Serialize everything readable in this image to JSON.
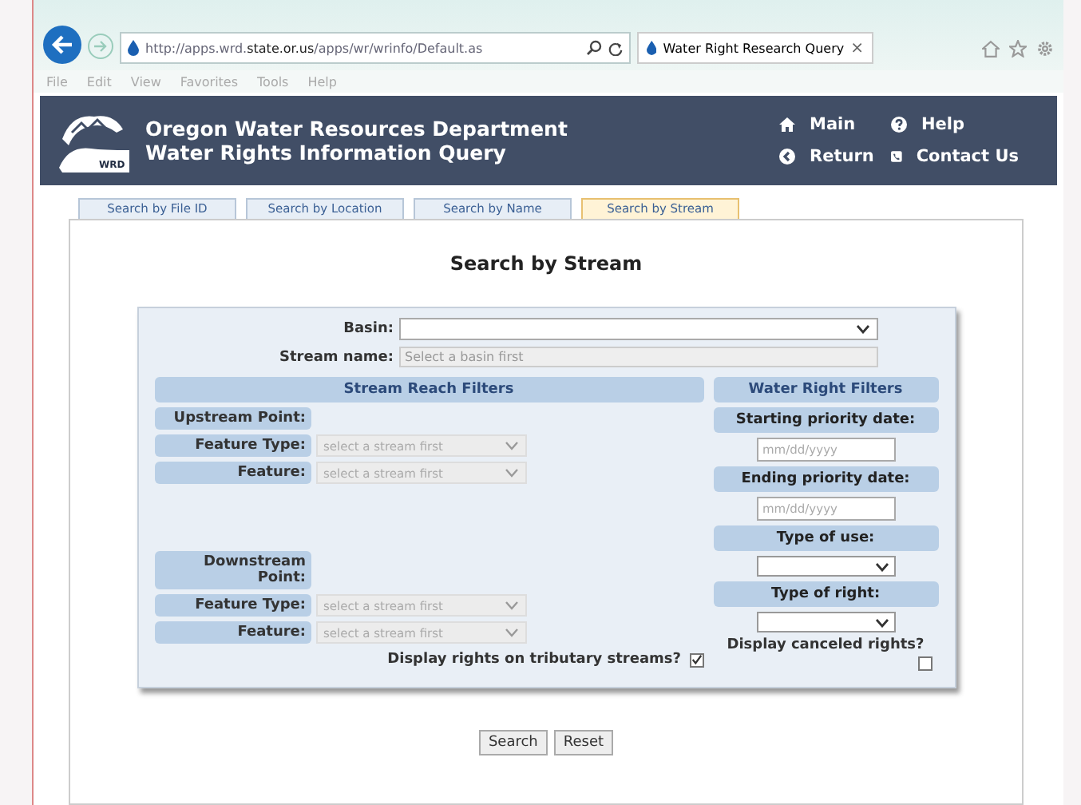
{
  "browser": {
    "address": "http://apps.wrd.**state.or.us**/apps/wr/wrinfo/Default.as",
    "tab_title": "Water Right Research Query",
    "tab_close": "×",
    "menu": [
      "File",
      "Edit",
      "View",
      "Favorites",
      "Tools",
      "Help"
    ]
  },
  "header": {
    "title_lines": [
      "Oregon Water Resources Department",
      "Water Rights Information Query"
    ],
    "logo_text": "WRD",
    "nav": [
      {
        "label": "Main",
        "kind": "home"
      },
      {
        "label": "Help",
        "kind": "help"
      },
      {
        "label": "Return",
        "kind": "return"
      },
      {
        "label": "Contact Us",
        "kind": "contact"
      }
    ]
  },
  "tabs": [
    {
      "label": "Search by File ID",
      "selected": false
    },
    {
      "label": "Search by Location",
      "selected": false
    },
    {
      "label": "Search by Name",
      "selected": false
    },
    {
      "label": "Search by Stream",
      "selected": true
    }
  ],
  "heading": "Search by Stream",
  "form": {
    "basin": {
      "label": "Basin:"
    },
    "stream": {
      "label": "Stream name:",
      "placeholder": "Select a basin first"
    },
    "reach": {
      "title": "Stream Reach Filters",
      "points": [
        {
          "label": "Upstream Point:",
          "rows": [
            {
              "label": "Feature Type:",
              "value": "select a stream first"
            },
            {
              "label": "Feature:",
              "value": "select a stream first"
            }
          ]
        },
        {
          "label": "Downstream Point:",
          "rows": [
            {
              "label": "Feature Type:",
              "value": "select a stream first"
            },
            {
              "label": "Feature:",
              "value": "select a stream first"
            }
          ]
        }
      ],
      "tributary": {
        "label": "Display rights on tributary streams?",
        "checked": true
      }
    },
    "rights": {
      "title": "Water Right Filters",
      "fields": [
        {
          "kind": "date",
          "label": "Starting priority date:",
          "placeholder": "mm/dd/yyyy"
        },
        {
          "kind": "date",
          "label": "Ending priority date:",
          "placeholder": "mm/dd/yyyy"
        },
        {
          "kind": "select",
          "label": "Type of use:"
        },
        {
          "kind": "select",
          "label": "Type of right:"
        }
      ],
      "canceled": {
        "label": "Display canceled rights?",
        "checked": false
      }
    }
  },
  "buttons": [
    "Search",
    "Reset"
  ]
}
